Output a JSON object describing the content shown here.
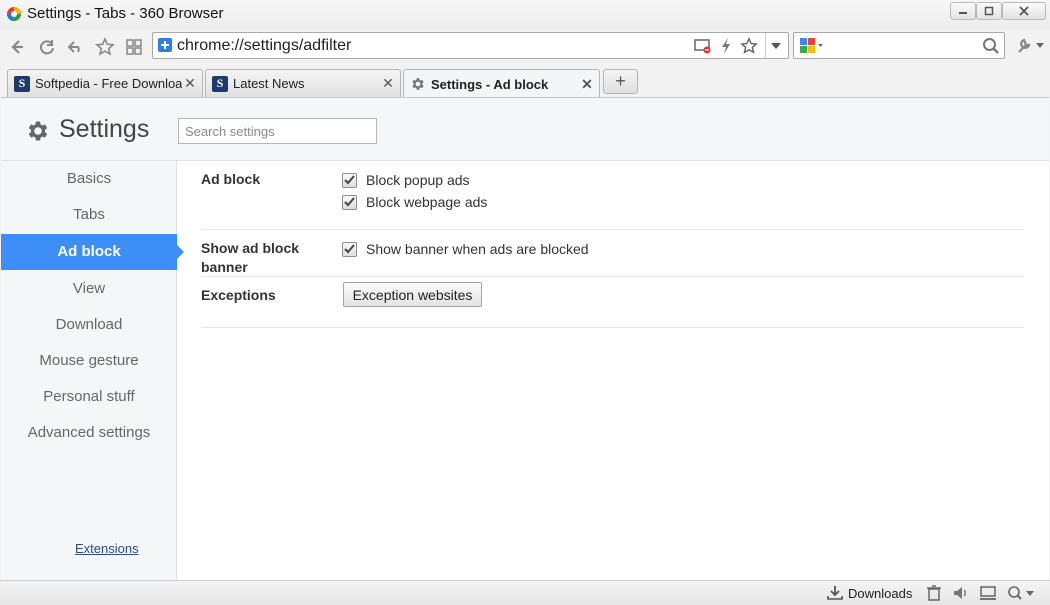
{
  "window": {
    "title": "Settings - Tabs - 360 Browser"
  },
  "navbar": {
    "url": "chrome://settings/adfilter"
  },
  "tabs": [
    {
      "title": "Softpedia - Free Downloa",
      "active": false,
      "icon": "softpedia-favicon"
    },
    {
      "title": "Latest News",
      "active": false,
      "icon": "softpedia-favicon"
    },
    {
      "title": "Settings - Ad block",
      "active": true,
      "icon": "gear-icon"
    }
  ],
  "settings": {
    "title": "Settings",
    "search_placeholder": "Search settings",
    "nav": [
      {
        "label": "Basics",
        "active": false
      },
      {
        "label": "Tabs",
        "active": false
      },
      {
        "label": "Ad block",
        "active": true
      },
      {
        "label": "View",
        "active": false
      },
      {
        "label": "Download",
        "active": false
      },
      {
        "label": "Mouse gesture",
        "active": false
      },
      {
        "label": "Personal stuff",
        "active": false
      },
      {
        "label": "Advanced settings",
        "active": false
      }
    ],
    "extensions_link": "Extensions",
    "sections": {
      "ad_block": {
        "label": "Ad block",
        "options": [
          {
            "label": "Block popup ads",
            "checked": true
          },
          {
            "label": "Block webpage ads",
            "checked": true
          }
        ]
      },
      "show_banner": {
        "label": "Show ad block banner",
        "option": {
          "label": "Show banner when ads are blocked",
          "checked": true
        }
      },
      "exceptions": {
        "label": "Exceptions",
        "button": "Exception websites"
      }
    }
  },
  "statusbar": {
    "downloads": "Downloads"
  },
  "colors": {
    "accent": "#3e8ef7",
    "sidebar_bg": "#f5f6f8"
  }
}
